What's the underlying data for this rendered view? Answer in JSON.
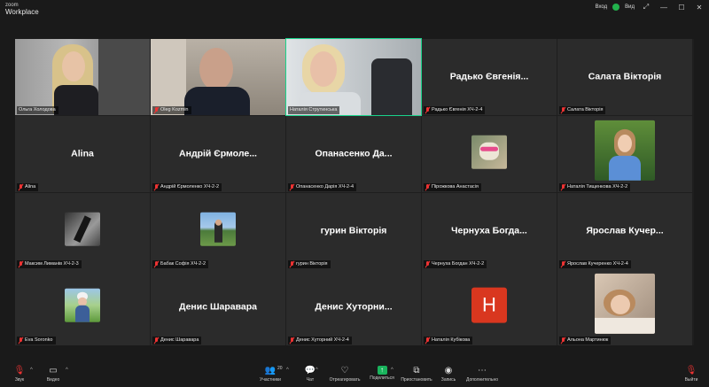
{
  "app": {
    "logo_line1": "zoom",
    "logo_line2": "Workplace"
  },
  "titlebar": {
    "view_label": "Вход",
    "view2_label": "Вид",
    "shield_color": "#22b14c"
  },
  "tiles": [
    {
      "big": "",
      "label": "Ольга Холодова",
      "muted": false,
      "video": "woman-blonde",
      "active": false
    },
    {
      "big": "",
      "label": "Oleg Kozmin",
      "muted": true,
      "video": "man-bald",
      "active": false
    },
    {
      "big": "",
      "label": "Наталія Струтинська",
      "muted": false,
      "video": "woman-light",
      "active": true
    },
    {
      "big": "Радько Євгенія...",
      "label": "Радько Євгенія ХЧ-2-4",
      "muted": true,
      "video": "",
      "active": false
    },
    {
      "big": "Салата Вікторія",
      "label": "Салата Вікторія",
      "muted": true,
      "video": "",
      "active": false
    },
    {
      "big": "Alina",
      "label": "Alina",
      "muted": true,
      "video": "",
      "active": false
    },
    {
      "big": "Андрій Єрмоле...",
      "label": "Андрій Єрмоленко ХЧ-2-2",
      "muted": true,
      "video": "",
      "active": false
    },
    {
      "big": "Опанасенко Да...",
      "label": "Опанасенко Дарія ХЧ-2-4",
      "muted": true,
      "video": "",
      "active": false
    },
    {
      "big": "",
      "label": "Пірожкова Анастасія",
      "muted": true,
      "video": "thumb-cat",
      "active": false
    },
    {
      "big": "",
      "label": "Наталія Тищенкова ХЧ-2-2",
      "muted": true,
      "video": "thumb-girl-green",
      "active": false
    },
    {
      "big": "",
      "label": "Максим Лиманів ХЧ-2-3",
      "muted": true,
      "video": "thumb-dark",
      "active": false
    },
    {
      "big": "",
      "label": "Бабак Софія ХЧ-2-2",
      "muted": true,
      "video": "thumb-landscape",
      "active": false
    },
    {
      "big": "гурин Вікторія",
      "label": "гурин Вікторія",
      "muted": true,
      "video": "",
      "active": false
    },
    {
      "big": "Чернуха Богда...",
      "label": "Чернуха Богдан ХЧ-2-2",
      "muted": true,
      "video": "",
      "active": false
    },
    {
      "big": "Ярослав Кучер...",
      "label": "Ярослав Кучеренко ХЧ-2-4",
      "muted": true,
      "video": "",
      "active": false
    },
    {
      "big": "",
      "label": "Eva Soronko",
      "muted": true,
      "video": "thumb-girl-field",
      "active": false
    },
    {
      "big": "Денис Шаравара",
      "label": "Денис Шаравара",
      "muted": true,
      "video": "",
      "active": false
    },
    {
      "big": "Денис Хуторни...",
      "label": "Денис Хуторний ХЧ-2-4",
      "muted": true,
      "video": "",
      "active": false
    },
    {
      "big": "",
      "label": "Наталія Кубікова",
      "muted": true,
      "video": "avatar-H",
      "avatar_letter": "H",
      "avatar_color": "#d9371f",
      "active": false
    },
    {
      "big": "",
      "label": "Альона Мартинюк",
      "muted": true,
      "video": "thumb-girl-bed",
      "active": false
    }
  ],
  "toolbar": {
    "audio": "Звук",
    "video": "Видео",
    "participants": "Участники",
    "participants_count": "20",
    "chat": "Чат",
    "react": "Отреагировать",
    "share": "Поделиться",
    "pause": "Приостановить",
    "record": "Запись",
    "more": "Дополнительно",
    "leave": "Выйти"
  }
}
